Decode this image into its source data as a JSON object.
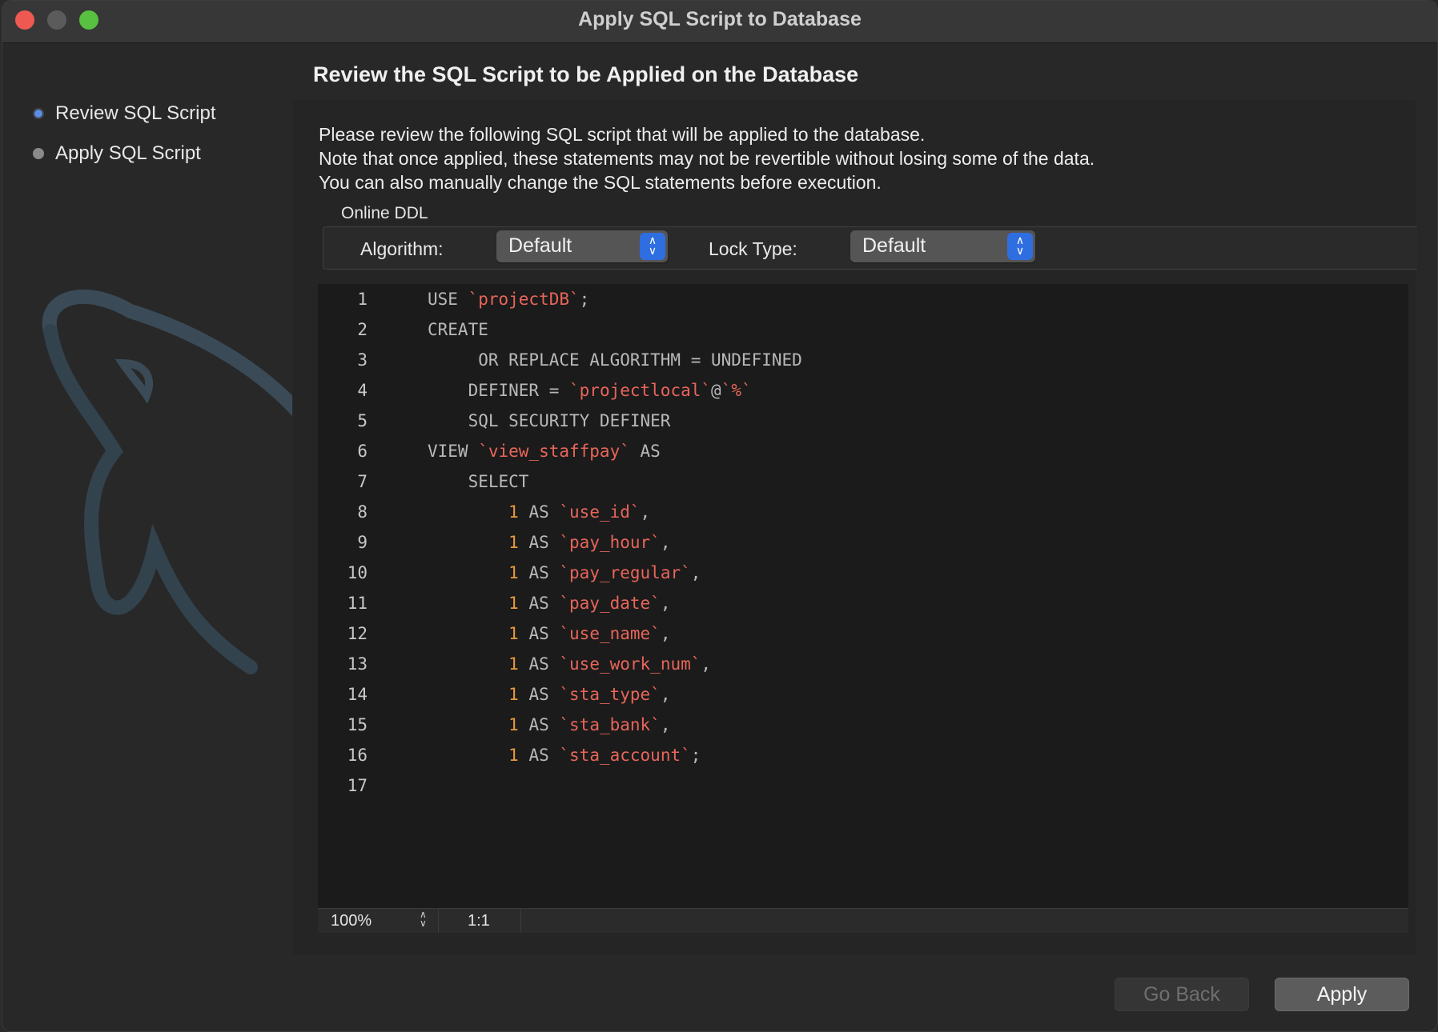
{
  "window": {
    "title": "Apply SQL Script to Database"
  },
  "sidebar": {
    "steps": [
      {
        "label": "Review SQL Script",
        "active": true
      },
      {
        "label": "Apply SQL Script",
        "active": false
      }
    ]
  },
  "main": {
    "heading": "Review the SQL Script to be Applied on the Database",
    "description": [
      "Please review the following SQL script that will be applied to the database.",
      "Note that once applied, these statements may not be revertible without losing some of the data.",
      "You can also manually change the SQL statements before execution."
    ],
    "online_ddl": {
      "label": "Online DDL",
      "algorithm_label": "Algorithm:",
      "algorithm_value": "Default",
      "lock_type_label": "Lock Type:",
      "lock_type_value": "Default"
    },
    "editor": {
      "lines": [
        {
          "num": "1",
          "text": "USE `projectDB`;"
        },
        {
          "num": "2",
          "text": "CREATE"
        },
        {
          "num": "3",
          "text": "     OR REPLACE ALGORITHM = UNDEFINED"
        },
        {
          "num": "4",
          "text": "    DEFINER = `projectlocal`@`%`"
        },
        {
          "num": "5",
          "text": "    SQL SECURITY DEFINER"
        },
        {
          "num": "6",
          "text": "VIEW `view_staffpay` AS"
        },
        {
          "num": "7",
          "text": "    SELECT"
        },
        {
          "num": "8",
          "text": "        1 AS `use_id`,"
        },
        {
          "num": "9",
          "text": "        1 AS `pay_hour`,"
        },
        {
          "num": "10",
          "text": "        1 AS `pay_regular`,"
        },
        {
          "num": "11",
          "text": "        1 AS `pay_date`,"
        },
        {
          "num": "12",
          "text": "        1 AS `use_name`,"
        },
        {
          "num": "13",
          "text": "        1 AS `use_work_num`,"
        },
        {
          "num": "14",
          "text": "        1 AS `sta_type`,"
        },
        {
          "num": "15",
          "text": "        1 AS `sta_bank`,"
        },
        {
          "num": "16",
          "text": "        1 AS `sta_account`;"
        },
        {
          "num": "17",
          "text": ""
        }
      ]
    },
    "status_bar": {
      "zoom": "100%",
      "cursor_position": "1:1"
    }
  },
  "footer": {
    "back_label": "Go Back",
    "apply_label": "Apply"
  },
  "colors": {
    "accent": "#2f6ee0",
    "string": "#e8655a",
    "number": "#e7993b",
    "close": "#ee5a52",
    "maximize": "#58c141"
  },
  "icons": {
    "close": "close-button",
    "minimize": "minimize-button",
    "maximize": "maximize-button",
    "select_arrows": "chevron-up-down-icon",
    "logo": "dolphin-logo"
  }
}
